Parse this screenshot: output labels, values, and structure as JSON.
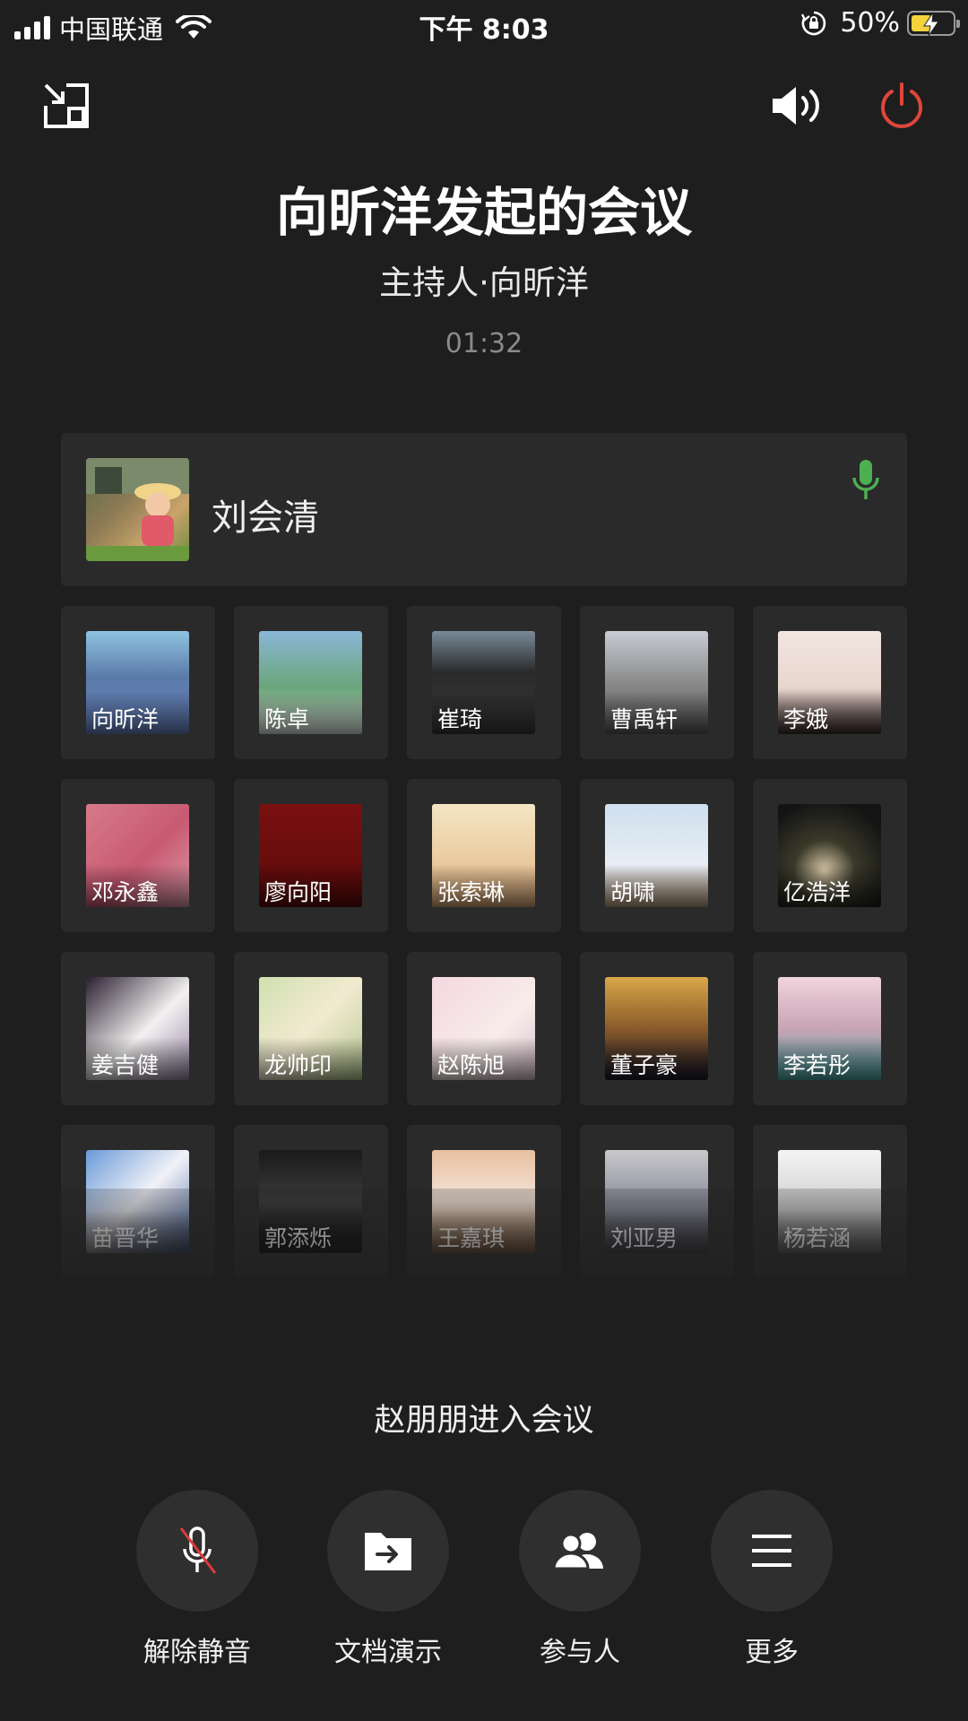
{
  "status_bar": {
    "carrier": "中国联通",
    "time": "下午 8:03",
    "battery_percent": "50%",
    "battery_level": 0.5,
    "battery_color": "#f4d33d"
  },
  "icons": {
    "minimize": "minimize-window-icon",
    "speaker": "speaker-volume-icon",
    "hangup": "power-hangup-icon",
    "speaking_mic": "microphone-icon",
    "mute": "microphone-muted-icon",
    "share_doc": "folder-share-icon",
    "participants": "people-icon",
    "more": "menu-lines-icon"
  },
  "colors": {
    "background": "#1e1e1e",
    "card": "#2a2a2a",
    "hangup_red": "#e0463a",
    "speaking_green": "#4caf50",
    "mute_slash_red": "#e03a3a"
  },
  "meeting": {
    "title": "向昕洋发起的会议",
    "host": "主持人·向昕洋",
    "duration": "01:32"
  },
  "active_speaker": {
    "name": "刘会清",
    "speaking": true
  },
  "participants": [
    {
      "name": "向昕洋"
    },
    {
      "name": "陈卓"
    },
    {
      "name": "崔琦"
    },
    {
      "name": "曹禹轩"
    },
    {
      "name": "李娥"
    },
    {
      "name": "邓永鑫"
    },
    {
      "name": "廖向阳"
    },
    {
      "name": "张索琳"
    },
    {
      "name": "胡啸"
    },
    {
      "name": "亿浩洋"
    },
    {
      "name": "姜吉健"
    },
    {
      "name": "龙帅印"
    },
    {
      "name": "赵陈旭"
    },
    {
      "name": "董子豪"
    },
    {
      "name": "李若彤"
    },
    {
      "name": "苗晋华"
    },
    {
      "name": "郭添烁"
    },
    {
      "name": "王嘉琪"
    },
    {
      "name": "刘亚男"
    },
    {
      "name": "杨若涵"
    }
  ],
  "notice": "赵朋朋进入会议",
  "toolbar": {
    "unmute_label": "解除静音",
    "share_label": "文档演示",
    "participants_label": "参与人",
    "more_label": "更多"
  }
}
